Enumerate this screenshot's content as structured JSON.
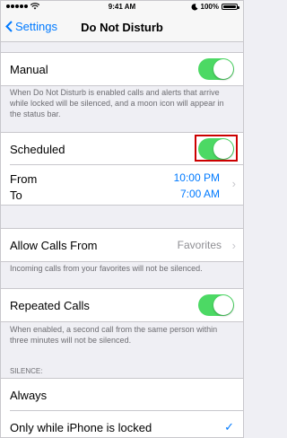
{
  "status_bar": {
    "time": "9:41 AM",
    "battery": "100%",
    "wifi_icon": "wifi-icon",
    "moon_icon": "moon-icon"
  },
  "nav": {
    "back_label": "Settings",
    "title": "Do Not Disturb"
  },
  "manual": {
    "label": "Manual",
    "on": true,
    "footer": "When Do Not Disturb is enabled calls and alerts that arrive while locked will be silenced, and a moon icon will appear in the status bar."
  },
  "scheduled": {
    "label": "Scheduled",
    "on": true,
    "from_label": "From",
    "to_label": "To",
    "from_value": "10:00 PM",
    "to_value": "7:00 AM"
  },
  "allow_calls": {
    "label": "Allow Calls From",
    "value": "Favorites",
    "footer": "Incoming calls from your favorites will not be silenced."
  },
  "repeated_calls": {
    "label": "Repeated Calls",
    "on": true,
    "footer": "When enabled, a second call from the same person within three minutes will not be silenced."
  },
  "silence": {
    "header": "SILENCE:",
    "options": [
      {
        "label": "Always",
        "selected": false
      },
      {
        "label": "Only while iPhone is locked",
        "selected": true
      }
    ]
  },
  "colors": {
    "accent": "#007aff",
    "toggle_on": "#4cd964",
    "highlight": "#cc0000"
  }
}
